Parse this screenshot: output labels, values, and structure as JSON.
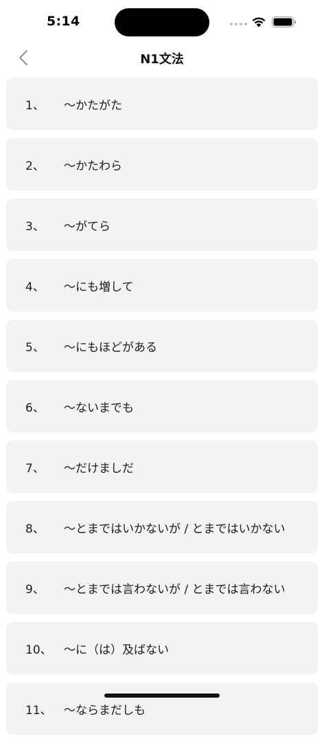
{
  "status_bar": {
    "time": "5:14"
  },
  "nav": {
    "title": "N1文法",
    "back_icon": "chevron-left-icon"
  },
  "items": [
    {
      "num": "1、",
      "text": "～かたがた"
    },
    {
      "num": "2、",
      "text": "～かたわら"
    },
    {
      "num": "3、",
      "text": "～がてら"
    },
    {
      "num": "4、",
      "text": "～にも増して"
    },
    {
      "num": "5、",
      "text": "～にもほどがある"
    },
    {
      "num": "6、",
      "text": "～ないまでも"
    },
    {
      "num": "7、",
      "text": "～だけましだ"
    },
    {
      "num": "8、",
      "text": "～とまではいかないが / とまではいかない"
    },
    {
      "num": "9、",
      "text": "～とまでは言わないが / とまでは言わない"
    },
    {
      "num": "10、",
      "text": "～に（は）及ばない"
    },
    {
      "num": "11、",
      "text": "～ならまだしも"
    }
  ]
}
